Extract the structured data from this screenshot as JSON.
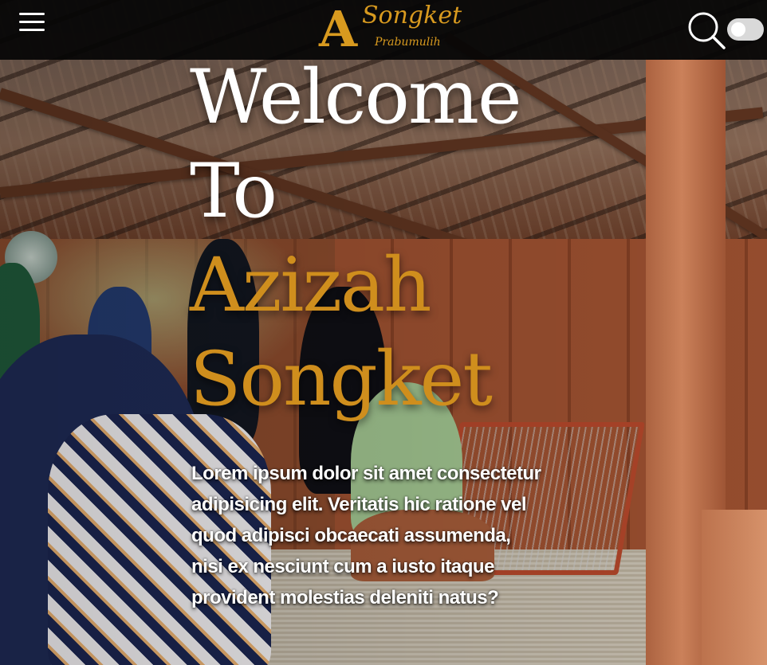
{
  "header": {
    "logo": {
      "mark": "A",
      "title": "Songket",
      "subtitle": "Prabumulih"
    },
    "menu_icon": "hamburger-menu-icon",
    "search_icon": "search-icon",
    "theme_toggle": {
      "state": "off"
    }
  },
  "hero": {
    "line1": "Welcome",
    "line2": "To",
    "line3": "Azizah",
    "line4": "Songket",
    "body": "Lorem ipsum dolor sit amet consectetur adipisicing elit. Veritatis hic ratione vel quod adipisci obcaecati assumenda, nisi ex nesciunt cum a iusto itaque provident molestias deleniti natus?"
  },
  "colors": {
    "accent": "#cf8e1d",
    "header_bg": "#050505",
    "hero_text": "#ffffff"
  }
}
